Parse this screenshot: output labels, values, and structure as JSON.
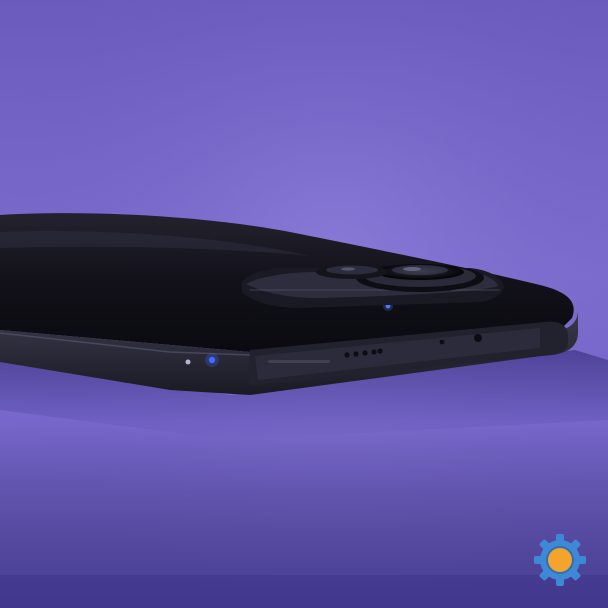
{
  "image": {
    "subject": "phone-lying-on-surface",
    "palette": {
      "background_top": "#6d5cc0",
      "background_mid": "#7e6fd0",
      "surface": "#6a5ec4",
      "phone_body": "#101018",
      "phone_edge": "#2a2a38",
      "accent_blue": "#3f6cff"
    }
  },
  "watermark": {
    "icon": "gear-icon",
    "ring_color": "#3f88d6",
    "center_color": "#f4a32c"
  }
}
